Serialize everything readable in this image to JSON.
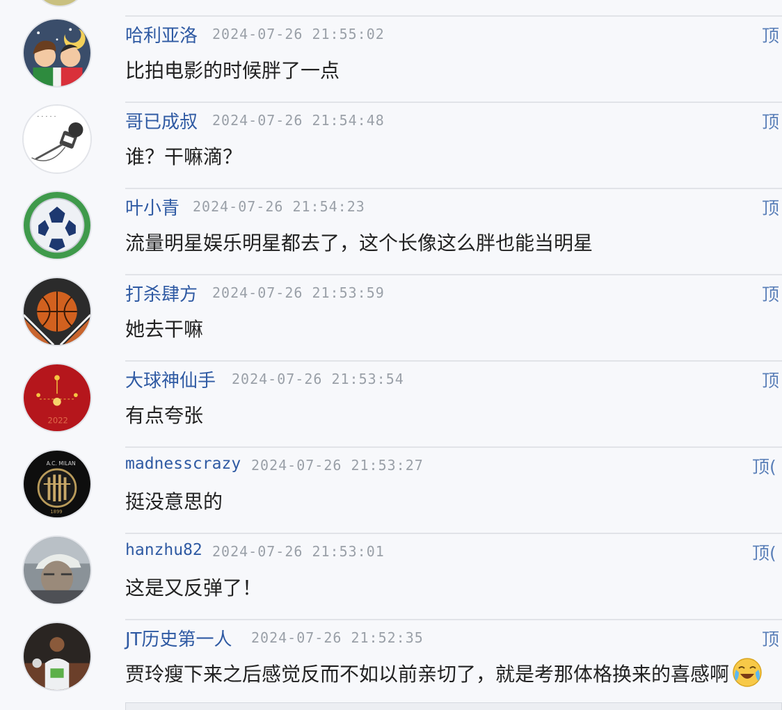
{
  "comments": [
    {
      "username": "哈利亚洛",
      "time": "2024-07-26 21:55:02",
      "text": "比拍电影的时候胖了一点",
      "upvote": "顶",
      "avatar_icon": "cartoon-couple-avatar"
    },
    {
      "username": "哥已成叔",
      "time": "2024-07-26 21:54:48",
      "text": "谁？干嘛滴？",
      "upvote": "顶",
      "avatar_icon": "microphone-avatar"
    },
    {
      "username": "叶小青",
      "time": "2024-07-26 21:54:23",
      "text": "流量明星娱乐明星都去了，这个长像这么胖也能当明星",
      "upvote": "顶",
      "avatar_icon": "soccer-ball-avatar"
    },
    {
      "username": "打杀肆方",
      "time": "2024-07-26 21:53:59",
      "text": "她去干嘛",
      "upvote": "顶",
      "avatar_icon": "basketball-avatar"
    },
    {
      "username": "大球神仙手",
      "time": "2024-07-26 21:53:54",
      "text": "有点夸张",
      "upvote": "顶",
      "avatar_icon": "red-new-year-avatar"
    },
    {
      "username": "madnesscrazy",
      "time": "2024-07-26 21:53:27",
      "text": "挺没意思的",
      "upvote": "顶(",
      "avatar_icon": "ac-milan-logo-avatar"
    },
    {
      "username": "hanzhu82",
      "time": "2024-07-26 21:53:01",
      "text": "这是又反弹了！",
      "upvote": "顶(",
      "avatar_icon": "man-with-cap-avatar"
    },
    {
      "username": "JT历史第一人",
      "time": "2024-07-26 21:52:35",
      "text": "贾玲瘦下来之后感觉反而不如以前亲切了，就是考那体格换来的喜感啊",
      "upvote": "顶",
      "avatar_icon": "basketball-player-avatar",
      "emoji": "crying-laughing-emoji"
    }
  ]
}
